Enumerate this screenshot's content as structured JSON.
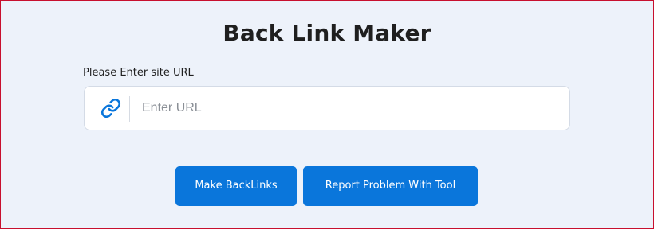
{
  "page": {
    "title": "Back Link Maker"
  },
  "form": {
    "label": "Please Enter site URL",
    "url_input": {
      "placeholder": "Enter URL",
      "value": "",
      "icon": "link-icon"
    }
  },
  "actions": {
    "make_backlinks_label": "Make BackLinks",
    "report_problem_label": "Report Problem With Tool"
  },
  "colors": {
    "page_background": "#edf2fa",
    "primary_button": "#0a76db",
    "icon_accent": "#0a76db",
    "frame_border": "#c8102e"
  }
}
